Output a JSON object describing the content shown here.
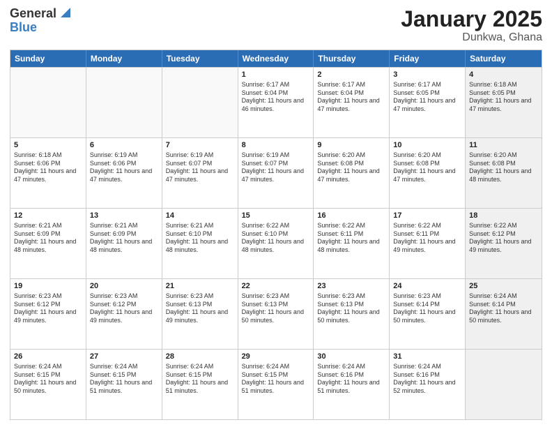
{
  "header": {
    "logo_general": "General",
    "logo_blue": "Blue",
    "month": "January 2025",
    "location": "Dunkwa, Ghana"
  },
  "weekdays": [
    "Sunday",
    "Monday",
    "Tuesday",
    "Wednesday",
    "Thursday",
    "Friday",
    "Saturday"
  ],
  "rows": [
    [
      {
        "day": "",
        "text": "",
        "shaded": false,
        "empty": true
      },
      {
        "day": "",
        "text": "",
        "shaded": false,
        "empty": true
      },
      {
        "day": "",
        "text": "",
        "shaded": false,
        "empty": true
      },
      {
        "day": "1",
        "text": "Sunrise: 6:17 AM\nSunset: 6:04 PM\nDaylight: 11 hours and 46 minutes.",
        "shaded": false,
        "empty": false
      },
      {
        "day": "2",
        "text": "Sunrise: 6:17 AM\nSunset: 6:04 PM\nDaylight: 11 hours and 47 minutes.",
        "shaded": false,
        "empty": false
      },
      {
        "day": "3",
        "text": "Sunrise: 6:17 AM\nSunset: 6:05 PM\nDaylight: 11 hours and 47 minutes.",
        "shaded": false,
        "empty": false
      },
      {
        "day": "4",
        "text": "Sunrise: 6:18 AM\nSunset: 6:05 PM\nDaylight: 11 hours and 47 minutes.",
        "shaded": true,
        "empty": false
      }
    ],
    [
      {
        "day": "5",
        "text": "Sunrise: 6:18 AM\nSunset: 6:06 PM\nDaylight: 11 hours and 47 minutes.",
        "shaded": false,
        "empty": false
      },
      {
        "day": "6",
        "text": "Sunrise: 6:19 AM\nSunset: 6:06 PM\nDaylight: 11 hours and 47 minutes.",
        "shaded": false,
        "empty": false
      },
      {
        "day": "7",
        "text": "Sunrise: 6:19 AM\nSunset: 6:07 PM\nDaylight: 11 hours and 47 minutes.",
        "shaded": false,
        "empty": false
      },
      {
        "day": "8",
        "text": "Sunrise: 6:19 AM\nSunset: 6:07 PM\nDaylight: 11 hours and 47 minutes.",
        "shaded": false,
        "empty": false
      },
      {
        "day": "9",
        "text": "Sunrise: 6:20 AM\nSunset: 6:08 PM\nDaylight: 11 hours and 47 minutes.",
        "shaded": false,
        "empty": false
      },
      {
        "day": "10",
        "text": "Sunrise: 6:20 AM\nSunset: 6:08 PM\nDaylight: 11 hours and 47 minutes.",
        "shaded": false,
        "empty": false
      },
      {
        "day": "11",
        "text": "Sunrise: 6:20 AM\nSunset: 6:08 PM\nDaylight: 11 hours and 48 minutes.",
        "shaded": true,
        "empty": false
      }
    ],
    [
      {
        "day": "12",
        "text": "Sunrise: 6:21 AM\nSunset: 6:09 PM\nDaylight: 11 hours and 48 minutes.",
        "shaded": false,
        "empty": false
      },
      {
        "day": "13",
        "text": "Sunrise: 6:21 AM\nSunset: 6:09 PM\nDaylight: 11 hours and 48 minutes.",
        "shaded": false,
        "empty": false
      },
      {
        "day": "14",
        "text": "Sunrise: 6:21 AM\nSunset: 6:10 PM\nDaylight: 11 hours and 48 minutes.",
        "shaded": false,
        "empty": false
      },
      {
        "day": "15",
        "text": "Sunrise: 6:22 AM\nSunset: 6:10 PM\nDaylight: 11 hours and 48 minutes.",
        "shaded": false,
        "empty": false
      },
      {
        "day": "16",
        "text": "Sunrise: 6:22 AM\nSunset: 6:11 PM\nDaylight: 11 hours and 48 minutes.",
        "shaded": false,
        "empty": false
      },
      {
        "day": "17",
        "text": "Sunrise: 6:22 AM\nSunset: 6:11 PM\nDaylight: 11 hours and 49 minutes.",
        "shaded": false,
        "empty": false
      },
      {
        "day": "18",
        "text": "Sunrise: 6:22 AM\nSunset: 6:12 PM\nDaylight: 11 hours and 49 minutes.",
        "shaded": true,
        "empty": false
      }
    ],
    [
      {
        "day": "19",
        "text": "Sunrise: 6:23 AM\nSunset: 6:12 PM\nDaylight: 11 hours and 49 minutes.",
        "shaded": false,
        "empty": false
      },
      {
        "day": "20",
        "text": "Sunrise: 6:23 AM\nSunset: 6:12 PM\nDaylight: 11 hours and 49 minutes.",
        "shaded": false,
        "empty": false
      },
      {
        "day": "21",
        "text": "Sunrise: 6:23 AM\nSunset: 6:13 PM\nDaylight: 11 hours and 49 minutes.",
        "shaded": false,
        "empty": false
      },
      {
        "day": "22",
        "text": "Sunrise: 6:23 AM\nSunset: 6:13 PM\nDaylight: 11 hours and 50 minutes.",
        "shaded": false,
        "empty": false
      },
      {
        "day": "23",
        "text": "Sunrise: 6:23 AM\nSunset: 6:13 PM\nDaylight: 11 hours and 50 minutes.",
        "shaded": false,
        "empty": false
      },
      {
        "day": "24",
        "text": "Sunrise: 6:23 AM\nSunset: 6:14 PM\nDaylight: 11 hours and 50 minutes.",
        "shaded": false,
        "empty": false
      },
      {
        "day": "25",
        "text": "Sunrise: 6:24 AM\nSunset: 6:14 PM\nDaylight: 11 hours and 50 minutes.",
        "shaded": true,
        "empty": false
      }
    ],
    [
      {
        "day": "26",
        "text": "Sunrise: 6:24 AM\nSunset: 6:15 PM\nDaylight: 11 hours and 50 minutes.",
        "shaded": false,
        "empty": false
      },
      {
        "day": "27",
        "text": "Sunrise: 6:24 AM\nSunset: 6:15 PM\nDaylight: 11 hours and 51 minutes.",
        "shaded": false,
        "empty": false
      },
      {
        "day": "28",
        "text": "Sunrise: 6:24 AM\nSunset: 6:15 PM\nDaylight: 11 hours and 51 minutes.",
        "shaded": false,
        "empty": false
      },
      {
        "day": "29",
        "text": "Sunrise: 6:24 AM\nSunset: 6:15 PM\nDaylight: 11 hours and 51 minutes.",
        "shaded": false,
        "empty": false
      },
      {
        "day": "30",
        "text": "Sunrise: 6:24 AM\nSunset: 6:16 PM\nDaylight: 11 hours and 51 minutes.",
        "shaded": false,
        "empty": false
      },
      {
        "day": "31",
        "text": "Sunrise: 6:24 AM\nSunset: 6:16 PM\nDaylight: 11 hours and 52 minutes.",
        "shaded": false,
        "empty": false
      },
      {
        "day": "",
        "text": "",
        "shaded": true,
        "empty": true
      }
    ]
  ]
}
